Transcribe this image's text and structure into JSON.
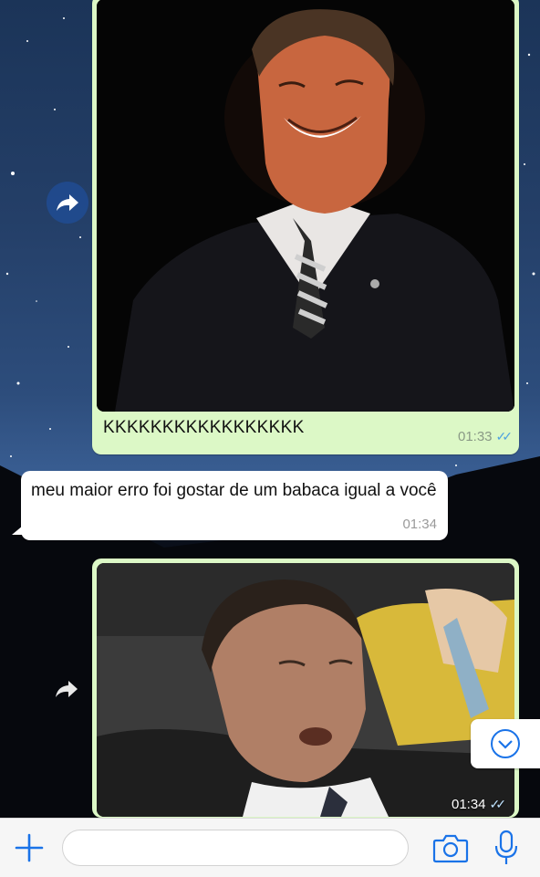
{
  "messages": [
    {
      "type": "outgoing-image",
      "caption": "KKKKKKKKKKKKKKKKK",
      "time": "01:33",
      "status": "read"
    },
    {
      "type": "incoming-text",
      "text": "meu maior erro foi gostar de um babaca igual a você",
      "time": "01:34"
    },
    {
      "type": "outgoing-image",
      "caption": "",
      "time": "01:34",
      "status": "read"
    }
  ],
  "composer": {
    "placeholder": ""
  },
  "icons": {
    "forward": "forward-arrow-icon",
    "scroll_down": "chevron-down-icon",
    "attach": "plus-icon",
    "camera": "camera-icon",
    "mic": "microphone-icon",
    "read_receipt": "double-check-icon"
  },
  "colors": {
    "outgoing_bubble": "#dcf8c6",
    "incoming_bubble": "#ffffff",
    "accent": "#007aff",
    "read_ticks": "#4fa3e0"
  }
}
